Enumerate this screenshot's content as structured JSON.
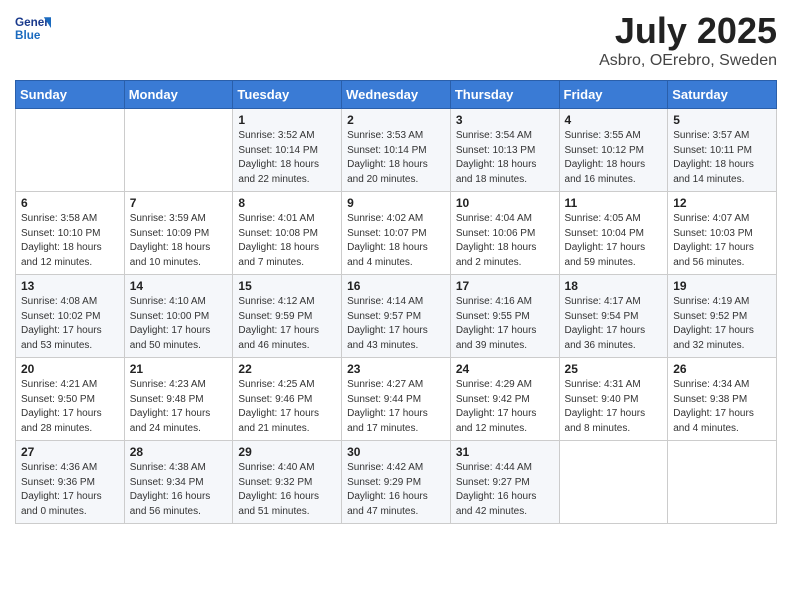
{
  "header": {
    "logo_text_general": "General",
    "logo_text_blue": "Blue",
    "month_year": "July 2025",
    "location": "Asbro, OErebro, Sweden"
  },
  "weekdays": [
    "Sunday",
    "Monday",
    "Tuesday",
    "Wednesday",
    "Thursday",
    "Friday",
    "Saturday"
  ],
  "weeks": [
    [
      {
        "day": "",
        "info": ""
      },
      {
        "day": "",
        "info": ""
      },
      {
        "day": "1",
        "info": "Sunrise: 3:52 AM\nSunset: 10:14 PM\nDaylight: 18 hours and 22 minutes."
      },
      {
        "day": "2",
        "info": "Sunrise: 3:53 AM\nSunset: 10:14 PM\nDaylight: 18 hours and 20 minutes."
      },
      {
        "day": "3",
        "info": "Sunrise: 3:54 AM\nSunset: 10:13 PM\nDaylight: 18 hours and 18 minutes."
      },
      {
        "day": "4",
        "info": "Sunrise: 3:55 AM\nSunset: 10:12 PM\nDaylight: 18 hours and 16 minutes."
      },
      {
        "day": "5",
        "info": "Sunrise: 3:57 AM\nSunset: 10:11 PM\nDaylight: 18 hours and 14 minutes."
      }
    ],
    [
      {
        "day": "6",
        "info": "Sunrise: 3:58 AM\nSunset: 10:10 PM\nDaylight: 18 hours and 12 minutes."
      },
      {
        "day": "7",
        "info": "Sunrise: 3:59 AM\nSunset: 10:09 PM\nDaylight: 18 hours and 10 minutes."
      },
      {
        "day": "8",
        "info": "Sunrise: 4:01 AM\nSunset: 10:08 PM\nDaylight: 18 hours and 7 minutes."
      },
      {
        "day": "9",
        "info": "Sunrise: 4:02 AM\nSunset: 10:07 PM\nDaylight: 18 hours and 4 minutes."
      },
      {
        "day": "10",
        "info": "Sunrise: 4:04 AM\nSunset: 10:06 PM\nDaylight: 18 hours and 2 minutes."
      },
      {
        "day": "11",
        "info": "Sunrise: 4:05 AM\nSunset: 10:04 PM\nDaylight: 17 hours and 59 minutes."
      },
      {
        "day": "12",
        "info": "Sunrise: 4:07 AM\nSunset: 10:03 PM\nDaylight: 17 hours and 56 minutes."
      }
    ],
    [
      {
        "day": "13",
        "info": "Sunrise: 4:08 AM\nSunset: 10:02 PM\nDaylight: 17 hours and 53 minutes."
      },
      {
        "day": "14",
        "info": "Sunrise: 4:10 AM\nSunset: 10:00 PM\nDaylight: 17 hours and 50 minutes."
      },
      {
        "day": "15",
        "info": "Sunrise: 4:12 AM\nSunset: 9:59 PM\nDaylight: 17 hours and 46 minutes."
      },
      {
        "day": "16",
        "info": "Sunrise: 4:14 AM\nSunset: 9:57 PM\nDaylight: 17 hours and 43 minutes."
      },
      {
        "day": "17",
        "info": "Sunrise: 4:16 AM\nSunset: 9:55 PM\nDaylight: 17 hours and 39 minutes."
      },
      {
        "day": "18",
        "info": "Sunrise: 4:17 AM\nSunset: 9:54 PM\nDaylight: 17 hours and 36 minutes."
      },
      {
        "day": "19",
        "info": "Sunrise: 4:19 AM\nSunset: 9:52 PM\nDaylight: 17 hours and 32 minutes."
      }
    ],
    [
      {
        "day": "20",
        "info": "Sunrise: 4:21 AM\nSunset: 9:50 PM\nDaylight: 17 hours and 28 minutes."
      },
      {
        "day": "21",
        "info": "Sunrise: 4:23 AM\nSunset: 9:48 PM\nDaylight: 17 hours and 24 minutes."
      },
      {
        "day": "22",
        "info": "Sunrise: 4:25 AM\nSunset: 9:46 PM\nDaylight: 17 hours and 21 minutes."
      },
      {
        "day": "23",
        "info": "Sunrise: 4:27 AM\nSunset: 9:44 PM\nDaylight: 17 hours and 17 minutes."
      },
      {
        "day": "24",
        "info": "Sunrise: 4:29 AM\nSunset: 9:42 PM\nDaylight: 17 hours and 12 minutes."
      },
      {
        "day": "25",
        "info": "Sunrise: 4:31 AM\nSunset: 9:40 PM\nDaylight: 17 hours and 8 minutes."
      },
      {
        "day": "26",
        "info": "Sunrise: 4:34 AM\nSunset: 9:38 PM\nDaylight: 17 hours and 4 minutes."
      }
    ],
    [
      {
        "day": "27",
        "info": "Sunrise: 4:36 AM\nSunset: 9:36 PM\nDaylight: 17 hours and 0 minutes."
      },
      {
        "day": "28",
        "info": "Sunrise: 4:38 AM\nSunset: 9:34 PM\nDaylight: 16 hours and 56 minutes."
      },
      {
        "day": "29",
        "info": "Sunrise: 4:40 AM\nSunset: 9:32 PM\nDaylight: 16 hours and 51 minutes."
      },
      {
        "day": "30",
        "info": "Sunrise: 4:42 AM\nSunset: 9:29 PM\nDaylight: 16 hours and 47 minutes."
      },
      {
        "day": "31",
        "info": "Sunrise: 4:44 AM\nSunset: 9:27 PM\nDaylight: 16 hours and 42 minutes."
      },
      {
        "day": "",
        "info": ""
      },
      {
        "day": "",
        "info": ""
      }
    ]
  ]
}
